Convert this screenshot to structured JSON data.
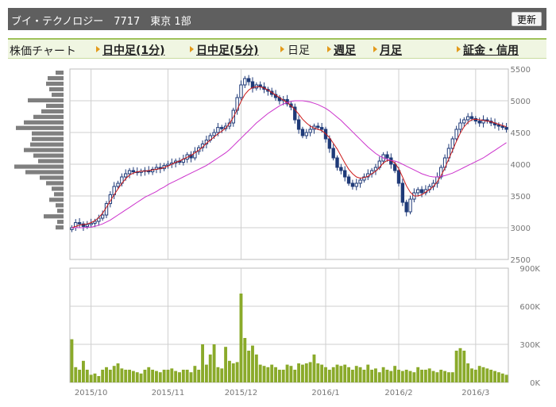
{
  "header": {
    "title": "ブイ・テクノロジー　7717　東京 1部",
    "refresh_label": "更新"
  },
  "nav": {
    "label": "株価チャート",
    "items": [
      {
        "label": "日中足(1分)",
        "active": true
      },
      {
        "label": "日中足(5分)",
        "active": true
      },
      {
        "label": "日足",
        "active": false
      },
      {
        "label": "週足",
        "active": true
      },
      {
        "label": "月足",
        "active": true
      },
      {
        "label": "証金・信用",
        "active": true
      }
    ]
  },
  "colors": {
    "candle": "#1f3a78",
    "ma_short": "#cc1a1a",
    "ma_long": "#cc33cc",
    "volume_bar": "#8aaa2a",
    "price_profile": "#7f7f7f",
    "grid": "#cfcfcf"
  },
  "chart_data": [
    {
      "type": "candlestick",
      "ylim": [
        2500,
        5500
      ],
      "yticks": [
        "5500",
        "5000",
        "4500",
        "4000",
        "3500",
        "3000",
        "2500"
      ],
      "xtick_labels": [
        "2015/10",
        "2015/11",
        "2015/12",
        "2016/1",
        "2016/2",
        "2016/3"
      ],
      "xtick_index": [
        5,
        25,
        44,
        66,
        85,
        105
      ],
      "close": [
        3000,
        3080,
        3060,
        3020,
        3050,
        3070,
        3100,
        3150,
        3200,
        3380,
        3520,
        3650,
        3700,
        3800,
        3850,
        3900,
        3880,
        3870,
        3890,
        3900,
        3880,
        3920,
        3950,
        3930,
        3980,
        4000,
        4020,
        4050,
        4030,
        4080,
        4150,
        4100,
        4200,
        4260,
        4320,
        4380,
        4450,
        4500,
        4580,
        4560,
        4600,
        4650,
        4850,
        5050,
        5250,
        5350,
        5300,
        5200,
        5250,
        5220,
        5180,
        5150,
        5100,
        5050,
        5000,
        5020,
        4950,
        4900,
        4700,
        4550,
        4450,
        4500,
        4550,
        4600,
        4580,
        4550,
        4400,
        4250,
        4100,
        3950,
        3900,
        3800,
        3700,
        3650,
        3700,
        3750,
        3800,
        3850,
        3900,
        3950,
        4050,
        4150,
        4100,
        4000,
        3900,
        3700,
        3400,
        3250,
        3450,
        3550,
        3600,
        3550,
        3600,
        3650,
        3700,
        3800,
        3950,
        4100,
        4250,
        4400,
        4550,
        4650,
        4700,
        4750,
        4720,
        4680,
        4650,
        4700,
        4680,
        4650,
        4620,
        4600,
        4580,
        4550
      ]
    },
    {
      "type": "line",
      "series": [
        {
          "values": [
            3000,
            3020,
            3040,
            3050,
            3060,
            3080,
            3110,
            3160,
            3230,
            3320,
            3420,
            3520,
            3610,
            3700,
            3770,
            3830,
            3860,
            3880,
            3890,
            3890,
            3900,
            3910,
            3920,
            3930,
            3950,
            3970,
            4000,
            4030,
            4050,
            4080,
            4110,
            4140,
            4180,
            4220,
            4270,
            4330,
            4380,
            4430,
            4480,
            4520,
            4570,
            4640,
            4740,
            4860,
            4990,
            5100,
            5170,
            5210,
            5220,
            5220,
            5200,
            5170,
            5130,
            5090,
            5050,
            5010,
            4970,
            4920,
            4860,
            4790,
            4710,
            4650,
            4600,
            4570,
            4550,
            4530,
            4480,
            4420,
            4330,
            4240,
            4130,
            4020,
            3920,
            3850,
            3800,
            3780,
            3790,
            3810,
            3850,
            3890,
            3950,
            4020,
            4060,
            4060,
            4020,
            3930,
            3800,
            3660,
            3560,
            3500,
            3500,
            3520,
            3560,
            3600,
            3650,
            3720,
            3820,
            3940,
            4080,
            4220,
            4360,
            4490,
            4590,
            4660,
            4700,
            4710,
            4700,
            4690,
            4680,
            4670,
            4650,
            4630,
            4610,
            4590
          ]
        },
        {
          "values": [
            3000,
            3000,
            3000,
            3000,
            3010,
            3010,
            3020,
            3040,
            3060,
            3090,
            3120,
            3160,
            3200,
            3240,
            3280,
            3320,
            3360,
            3400,
            3440,
            3480,
            3510,
            3540,
            3570,
            3610,
            3640,
            3680,
            3710,
            3740,
            3770,
            3800,
            3830,
            3860,
            3890,
            3920,
            3950,
            3980,
            4020,
            4060,
            4100,
            4140,
            4180,
            4230,
            4290,
            4350,
            4410,
            4470,
            4530,
            4590,
            4650,
            4700,
            4750,
            4800,
            4840,
            4880,
            4920,
            4950,
            4970,
            4990,
            5000,
            5000,
            5000,
            4990,
            4980,
            4960,
            4940,
            4910,
            4880,
            4840,
            4790,
            4740,
            4690,
            4630,
            4570,
            4510,
            4450,
            4390,
            4330,
            4270,
            4220,
            4170,
            4130,
            4100,
            4080,
            4060,
            4050,
            4030,
            4000,
            3970,
            3940,
            3910,
            3880,
            3850,
            3830,
            3810,
            3800,
            3800,
            3810,
            3820,
            3840,
            3860,
            3890,
            3920,
            3950,
            3980,
            4010,
            4040,
            4070,
            4100,
            4140,
            4180,
            4220,
            4260,
            4300,
            4340
          ]
        }
      ]
    },
    {
      "type": "bar",
      "ylim": [
        0,
        900
      ],
      "ytick_labels": [
        "900K",
        "600K",
        "300K",
        "0K"
      ],
      "values": [
        340,
        120,
        100,
        170,
        100,
        60,
        70,
        50,
        100,
        120,
        100,
        130,
        150,
        110,
        100,
        100,
        90,
        80,
        70,
        100,
        120,
        100,
        90,
        80,
        100,
        100,
        110,
        90,
        80,
        100,
        100,
        80,
        130,
        100,
        300,
        140,
        220,
        300,
        120,
        110,
        280,
        170,
        150,
        160,
        700,
        350,
        250,
        290,
        220,
        140,
        130,
        120,
        140,
        120,
        100,
        100,
        140,
        130,
        100,
        150,
        140,
        150,
        160,
        220,
        150,
        140,
        120,
        100,
        120,
        140,
        130,
        140,
        120,
        100,
        130,
        120,
        100,
        140,
        100,
        110,
        80,
        120,
        100,
        90,
        130,
        100,
        90,
        100,
        90,
        80,
        120,
        100,
        100,
        110,
        90,
        80,
        100,
        90,
        80,
        80,
        250,
        270,
        250,
        150,
        110,
        100,
        130,
        120,
        110,
        100,
        90,
        80,
        70,
        60
      ]
    },
    {
      "type": "bar",
      "orientation": "horizontal",
      "values": [
        10,
        20,
        22,
        18,
        15,
        45,
        22,
        28,
        38,
        50,
        60,
        40,
        40,
        42,
        50,
        38,
        32,
        62,
        48,
        30,
        22,
        15,
        12,
        18,
        10,
        8,
        25,
        8,
        10
      ]
    }
  ]
}
